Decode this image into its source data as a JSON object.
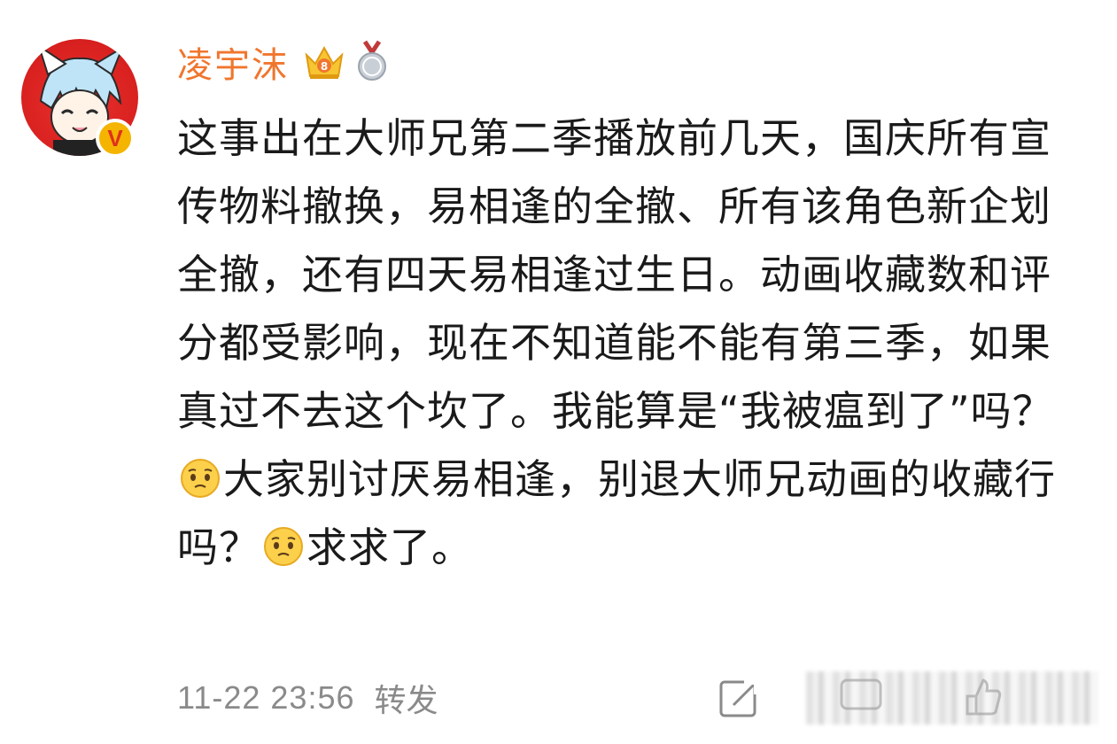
{
  "user": {
    "name": "凌宇沫",
    "verified_badge": "V",
    "icons": [
      "crown-icon",
      "medal-icon"
    ]
  },
  "post": {
    "text": "这事出在大师兄第二季播放前几天，国庆所有宣传物料撤换，易相逢的全撤、所有该角色新企划全撤，还有四天易相逢过生日。动画收藏数和评分都受影响，现在不知道能不能有第三季，如果真过不去这个坎了。我能算是“我被瘟到了”吗？",
    "text_part2": "大家别讨厌易相逢，别退大师兄动画的收藏行吗？",
    "text_part3": "求求了。"
  },
  "footer": {
    "time": "11-22 23:56",
    "repost": "转发"
  },
  "colors": {
    "username": "#f0762e",
    "text": "#1a1a1a",
    "meta": "#8a8a8a",
    "badge": "#f4b400"
  }
}
